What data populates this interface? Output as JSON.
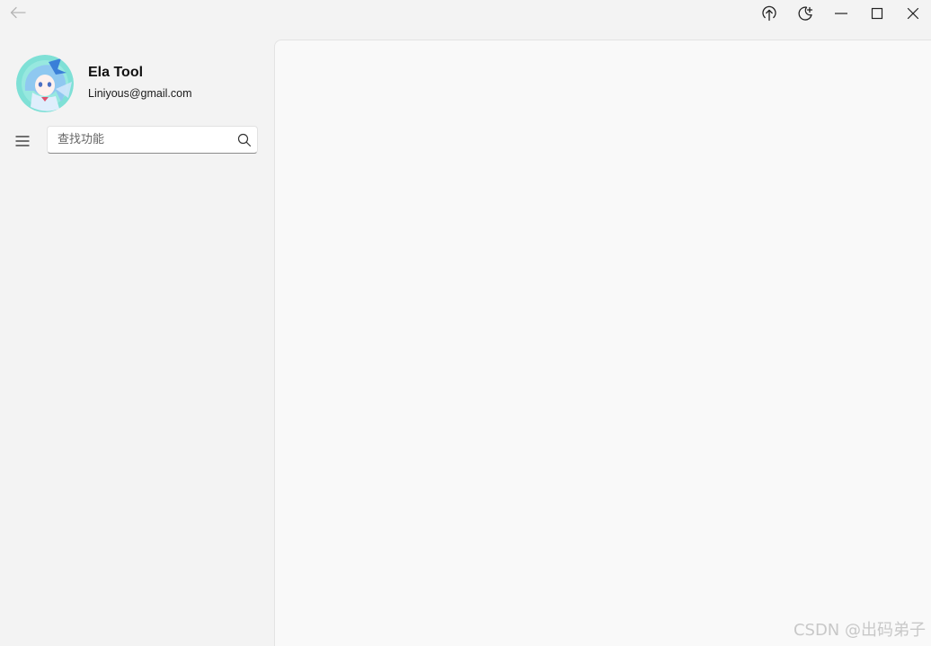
{
  "titlebar": {
    "back_icon": "arrow-left-icon",
    "controls": [
      {
        "name": "upload-icon"
      },
      {
        "name": "theme-toggle-icon"
      },
      {
        "name": "minimize-icon"
      },
      {
        "name": "maximize-icon"
      },
      {
        "name": "close-icon"
      }
    ]
  },
  "user": {
    "name": "Ela Tool",
    "email": "Liniyous@gmail.com",
    "avatar_colors": {
      "background": "#7fe0d6",
      "hair": "#8fc8f0",
      "bow": "#3a7fd8"
    }
  },
  "navigation": {
    "menu_icon": "hamburger-menu-icon",
    "search": {
      "placeholder": "查找功能",
      "value": "",
      "icon": "search-icon"
    }
  },
  "watermark": "CSDN @出码弟子",
  "colors": {
    "window_bg": "#f3f3f3",
    "content_bg": "#f9f9f9",
    "border": "#e3e3e3"
  }
}
